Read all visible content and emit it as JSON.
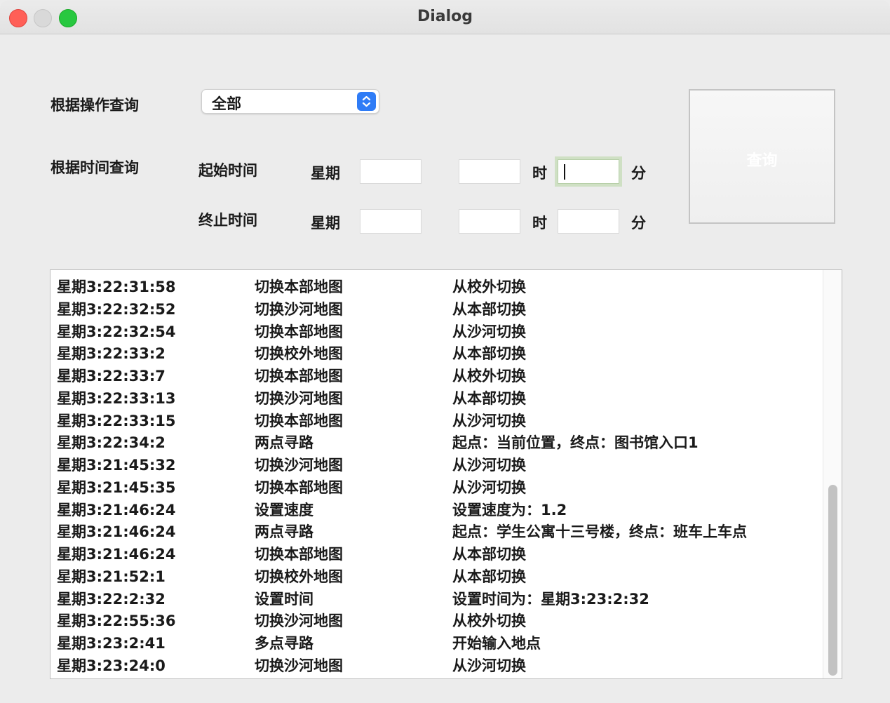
{
  "window": {
    "title": "Dialog"
  },
  "filters": {
    "op_label": "根据操作查询",
    "op_selected": "全部",
    "time_label": "根据时间查询",
    "start_label": "起始时间",
    "end_label": "终止时间",
    "weekday_label": "星期",
    "hour_unit": "时",
    "minute_unit": "分",
    "start": {
      "weekday": "",
      "hour": "",
      "minute": ""
    },
    "end": {
      "weekday": "",
      "hour": "",
      "minute": ""
    }
  },
  "query_button": {
    "label": "查询"
  },
  "log": {
    "rows": [
      [
        "星期3:22:31:58",
        "切换本部地图",
        "从校外切换"
      ],
      [
        "星期3:22:32:52",
        "切换沙河地图",
        "从本部切换"
      ],
      [
        "星期3:22:32:54",
        "切换本部地图",
        "从沙河切换"
      ],
      [
        "星期3:22:33:2",
        "切换校外地图",
        "从本部切换"
      ],
      [
        "星期3:22:33:7",
        "切换本部地图",
        "从校外切换"
      ],
      [
        "星期3:22:33:13",
        "切换沙河地图",
        "从本部切换"
      ],
      [
        "星期3:22:33:15",
        "切换本部地图",
        "从沙河切换"
      ],
      [
        "星期3:22:34:2",
        "两点寻路",
        "起点：当前位置，终点：图书馆入口1"
      ],
      [
        "星期3:21:45:32",
        "切换沙河地图",
        "从沙河切换"
      ],
      [
        "星期3:21:45:35",
        "切换本部地图",
        "从沙河切换"
      ],
      [
        "星期3:21:46:24",
        "设置速度",
        "设置速度为：1.2"
      ],
      [
        "星期3:21:46:24",
        "两点寻路",
        "起点：学生公寓十三号楼，终点：班车上车点"
      ],
      [
        "星期3:21:46:24",
        "切换本部地图",
        "从本部切换"
      ],
      [
        "星期3:21:52:1",
        "切换校外地图",
        "从本部切换"
      ],
      [
        "星期3:22:2:32",
        "设置时间",
        "设置时间为：星期3:23:2:32"
      ],
      [
        "星期3:22:55:36",
        "切换沙河地图",
        "从校外切换"
      ],
      [
        "星期3:23:2:41",
        "多点寻路",
        "开始输入地点"
      ],
      [
        "星期3:23:24:0",
        "切换沙河地图",
        "从沙河切换"
      ]
    ]
  }
}
